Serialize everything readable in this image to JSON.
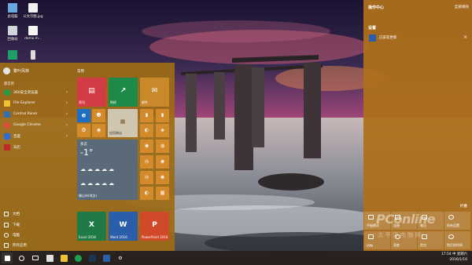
{
  "desktop": {
    "icons": [
      {
        "label": "此电脑",
        "icon": "computer-icon"
      },
      {
        "label": "公文示图.jpg",
        "icon": "image-file-icon"
      },
      {
        "label": "回收站",
        "icon": "recycle-bin-icon"
      },
      {
        "label": "demo.m...",
        "icon": "file-icon"
      },
      {
        "label": "",
        "icon": "app-icon"
      }
    ]
  },
  "start_menu": {
    "user_name": "繁叶风林",
    "most_used_label": "最常用",
    "apps": [
      {
        "label": "360安全浏览器",
        "color": "#1aa24b"
      },
      {
        "label": "File Explorer",
        "color": "#f1c232"
      },
      {
        "label": "Control Panel",
        "color": "#2f6fb3"
      },
      {
        "label": "Google Chrome",
        "color": "#dd4b39"
      },
      {
        "label": "百度",
        "color": "#2d6cd6"
      },
      {
        "label": "日历",
        "color": "#c1272d"
      }
    ],
    "bottom_items": [
      {
        "label": "文档"
      },
      {
        "label": "下载"
      },
      {
        "label": "电脑"
      },
      {
        "label": "所有应用"
      }
    ],
    "tiles_group_label": "常用",
    "tiles": {
      "news": "资讯",
      "finance": "财经",
      "mail": "邮件",
      "store": "应用商店",
      "weather_city": "多云",
      "weather_temp": "-1°",
      "weather_location": "佛山市(地点)",
      "excel": "Excel 2016",
      "word": "Word 2016",
      "powerpoint": "PowerPoint 2016"
    }
  },
  "action_center": {
    "title": "操作中心",
    "clear_all": "全部清除",
    "section": "设置",
    "notification": "已安装更新",
    "collapse": "折叠",
    "quick_actions": [
      {
        "label": "平板模式"
      },
      {
        "label": "连接"
      },
      {
        "label": "笔记"
      },
      {
        "label": "所有设置"
      },
      {
        "label": "VPN"
      },
      {
        "label": "亮度"
      },
      {
        "label": "定位"
      },
      {
        "label": "免打扰时间"
      }
    ]
  },
  "watermark": {
    "brand": "PConline",
    "sub": "太平洋电脑网"
  },
  "taskbar": {
    "time": "17:54",
    "date": "2016/1/16",
    "ime": "中",
    "day": "星期六"
  }
}
